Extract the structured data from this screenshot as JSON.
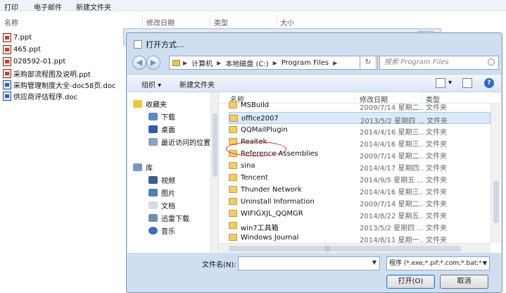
{
  "background": {
    "toolbar": [
      "打印",
      "电子邮件",
      "新建文件夹"
    ],
    "columns": [
      "名称",
      "修改日期",
      "类型",
      "大小"
    ],
    "files": [
      {
        "name": "7.ppt",
        "kind": "ppt"
      },
      {
        "name": "465.ppt",
        "kind": "ppt"
      },
      {
        "name": "028592-01.ppt",
        "kind": "ppt"
      },
      {
        "name": "采购部流程图及说明.ppt",
        "kind": "ppt"
      },
      {
        "name": "采购管理制度大全-doc58页.doc",
        "kind": "doc"
      },
      {
        "name": "供应商评估程序.doc",
        "kind": "doc"
      }
    ],
    "ghost_close": "X"
  },
  "dialog": {
    "title": "打开方式...",
    "breadcrumb": [
      "计算机",
      "本地磁盘 (C:)",
      "Program Files"
    ],
    "search_placeholder": "搜索 Program Files",
    "toolbar": {
      "organize": "组织 ▾",
      "new_folder": "新建文件夹",
      "help": "?"
    },
    "nav": {
      "favorites": "收藏夹",
      "favorites_items": [
        "下载",
        "桌面",
        "最近访问的位置"
      ],
      "libraries": "库",
      "library_items": [
        "视频",
        "图片",
        "文档",
        "迅雷下载",
        "音乐"
      ]
    },
    "columns": {
      "name": "名称",
      "date": "修改日期",
      "type": "类型"
    },
    "rows": [
      {
        "name": "MSBuild",
        "date": "2009/7/14 星期二...",
        "type": "文件夹"
      },
      {
        "name": "office2007",
        "date": "2013/5/2 星期四 ...",
        "type": "文件夹"
      },
      {
        "name": "QQMailPlugin",
        "date": "2014/4/16 星期三...",
        "type": "文件夹"
      },
      {
        "name": "Realtek",
        "date": "2014/4/16 星期三...",
        "type": "文件夹"
      },
      {
        "name": "Reference Assemblies",
        "date": "2009/7/14 星期二...",
        "type": "文件夹"
      },
      {
        "name": "sina",
        "date": "2014/4/17 星期四...",
        "type": "文件夹"
      },
      {
        "name": "Tencent",
        "date": "2014/9/5 星期五 ...",
        "type": "文件夹"
      },
      {
        "name": "Thunder Network",
        "date": "2014/4/16 星期三...",
        "type": "文件夹"
      },
      {
        "name": "Uninstall Information",
        "date": "2009/7/14 星期二...",
        "type": "文件夹"
      },
      {
        "name": "WIFIGXJL_QQMGR",
        "date": "2014/8/22 星期五...",
        "type": "文件夹"
      },
      {
        "name": "win7工具箱",
        "date": "2013/5/2 星期四 ...",
        "type": "文件夹"
      },
      {
        "name": "Windows Journal",
        "date": "2014/8/11 星期一...",
        "type": "文件夹"
      }
    ],
    "filename_label": "文件名(N):",
    "filename_value": "",
    "filetype": "程序 (*.exe;*.pif;*.com;*.bat;*.",
    "open_button": "打开(O)",
    "cancel_button": "取消"
  }
}
